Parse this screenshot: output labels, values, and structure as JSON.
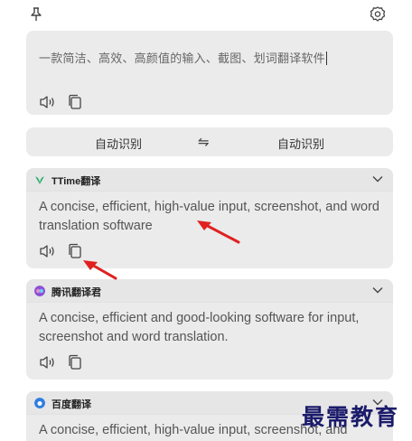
{
  "toolbar": {
    "pin_icon": "pin-icon",
    "settings_icon": "gear-icon"
  },
  "input": {
    "text": "一款简洁、高效、高颜值的输入、截图、划词翻译软件",
    "icons": [
      "speaker-icon",
      "copy-icon"
    ]
  },
  "language": {
    "source": "自动识别",
    "swap": "⇋",
    "target": "自动识别"
  },
  "results": [
    {
      "service": "TTime翻译",
      "logo_color": "#1aa861",
      "text": "A concise, efficient, high-value input, screenshot, and word translation software"
    },
    {
      "service": "腾讯翻译君",
      "logo_color": "#8b4fd6",
      "text": "A concise, efficient and good-looking software for input, screenshot and word translation."
    },
    {
      "service": "百度翻译",
      "logo_color": "#2f7de1",
      "text": "A concise, efficient, high-value input, screenshot, and"
    }
  ],
  "annotation_color": "#e02020",
  "watermark": "最需教育"
}
